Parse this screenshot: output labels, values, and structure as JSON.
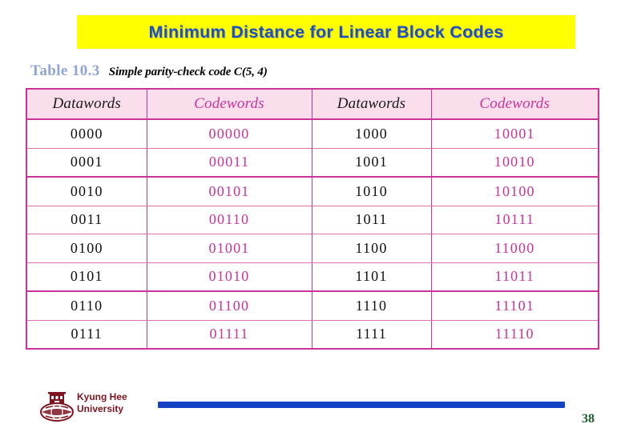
{
  "slide": {
    "title": "Minimum Distance for Linear Block Codes",
    "title_bg_color": "#ffff00",
    "title_text_color": "#1f4fc4"
  },
  "caption": {
    "label": "Table 10.3",
    "label_color": "#8fa5d8",
    "title": "Simple parity-check code C(5, 4)"
  },
  "table": {
    "accent_color": "#cc3399",
    "header_bg_color": "#fadeeb",
    "headers": [
      "Datawords",
      "Codewords",
      "Datawords",
      "Codewords"
    ],
    "rows": [
      [
        "0000",
        "00000",
        "1000",
        "10001"
      ],
      [
        "0001",
        "00011",
        "1001",
        "10010"
      ],
      [
        "0010",
        "00101",
        "1010",
        "10100"
      ],
      [
        "0011",
        "00110",
        "1011",
        "10111"
      ],
      [
        "0100",
        "01001",
        "1100",
        "11000"
      ],
      [
        "0101",
        "01010",
        "1101",
        "11011"
      ],
      [
        "0110",
        "01100",
        "1110",
        "11101"
      ],
      [
        "0111",
        "01111",
        "1111",
        "11110"
      ]
    ]
  },
  "footer": {
    "university_line1": "Kyung Hee",
    "university_line2": "University",
    "university_color": "#7d1420",
    "rule_color": "#1542c4",
    "page_number": "38",
    "page_number_color": "#1a5e2a"
  }
}
